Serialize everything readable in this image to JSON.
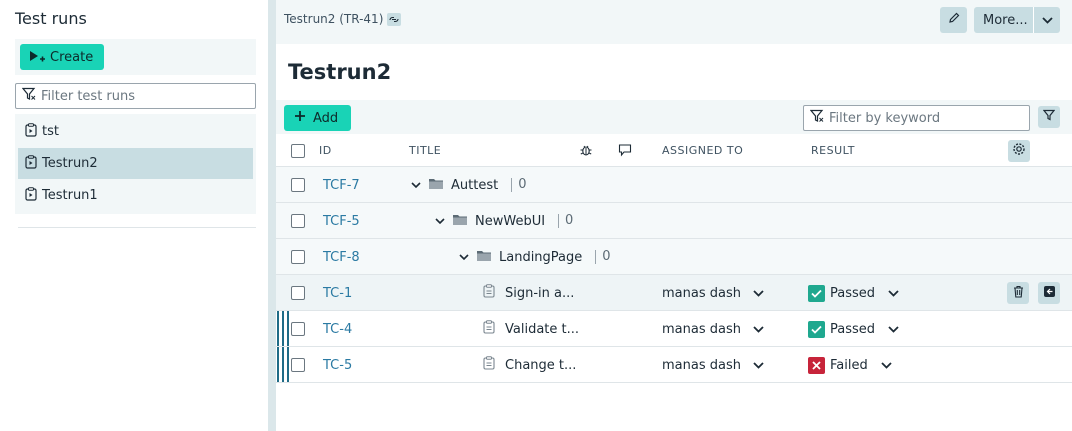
{
  "sidebar": {
    "title": "Test runs",
    "create_label": "Create",
    "filter_placeholder": "Filter test runs",
    "runs": [
      {
        "label": "tst",
        "selected": false
      },
      {
        "label": "Testrun2",
        "selected": true
      },
      {
        "label": "Testrun1",
        "selected": false
      }
    ]
  },
  "header": {
    "breadcrumb": "Testrun2 (TR-41)",
    "more_label": "More...",
    "page_title": "Testrun2"
  },
  "toolbar": {
    "add_label": "Add",
    "keyword_placeholder": "Filter by keyword"
  },
  "table": {
    "columns": {
      "id": "ID",
      "title": "TITLE",
      "assigned_to": "ASSIGNED TO",
      "result": "RESULT"
    },
    "folders": [
      {
        "id": "TCF-7",
        "title": "Auttest",
        "count": "0"
      },
      {
        "id": "TCF-5",
        "title": "NewWebUI",
        "count": "0"
      },
      {
        "id": "TCF-8",
        "title": "LandingPage",
        "count": "0"
      }
    ],
    "cases": [
      {
        "id": "TC-1",
        "title": "Sign-in a...",
        "assignee": "manas dash",
        "result": "Passed"
      },
      {
        "id": "TC-4",
        "title": "Validate t...",
        "assignee": "manas dash",
        "result": "Passed"
      },
      {
        "id": "TC-5",
        "title": "Change t...",
        "assignee": "manas dash",
        "result": "Failed"
      }
    ]
  },
  "colors": {
    "accent": "#19d3b6",
    "passed": "#1fa88f",
    "failed": "#c7243a",
    "selected": "#c8dde2",
    "link": "#2b7aa3"
  }
}
